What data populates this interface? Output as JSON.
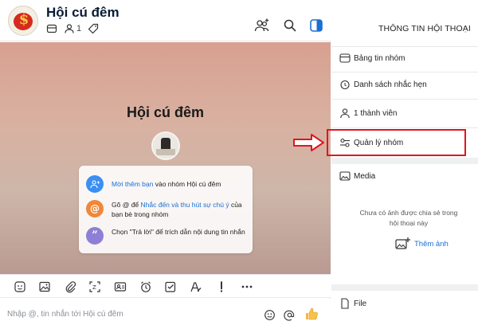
{
  "header": {
    "title": "Hội cú đêm",
    "member_count": "1",
    "avatar_glyph": "$"
  },
  "welcome": {
    "title": "Hội cú đêm",
    "items": [
      {
        "icon": "invite-friends-icon",
        "color": "#3a8ff2",
        "link": "Mời thêm bạn",
        "text": " vào nhóm Hội cú đêm",
        "tail": ""
      },
      {
        "icon": "at-mention-icon",
        "color": "#f0873a",
        "text": "Gõ @ để ",
        "link": "Nhắc đến và thu hút sự chú ý",
        "tail": " của bạn bè trong nhóm"
      },
      {
        "icon": "quote-icon",
        "color": "#8e7fd6",
        "text": "Chọn \"Trả lời\" để trích dẫn nội dung tin nhắn",
        "link": "",
        "tail": ""
      }
    ]
  },
  "toolbar": {
    "icons": [
      "sticker-icon",
      "image-icon",
      "attachment-icon",
      "screenshot-icon",
      "contact-card-icon",
      "reminder-icon",
      "task-icon",
      "text-format-icon",
      "important-icon",
      "more-icon"
    ]
  },
  "composer": {
    "placeholder": "Nhập @, tin nhắn tới Hội cú đêm"
  },
  "panel": {
    "title": "THÔNG TIN HỘI THOẠI",
    "items": [
      {
        "icon": "bulletin-board-icon",
        "label": "Bảng tin nhóm"
      },
      {
        "icon": "alarm-clock-icon",
        "label": "Danh sách nhắc hẹn"
      },
      {
        "icon": "member-icon",
        "label": "1 thành viên"
      },
      {
        "icon": "group-settings-icon",
        "label": "Quản lý nhóm"
      }
    ],
    "media": {
      "label": "Media",
      "empty_text": "Chưa có ảnh được chia sẻ trong hội thoại này",
      "add_label": "Thêm ảnh"
    },
    "file_label": "File"
  },
  "colors": {
    "accent": "#1a6fd6",
    "highlight": "#e0161e"
  }
}
